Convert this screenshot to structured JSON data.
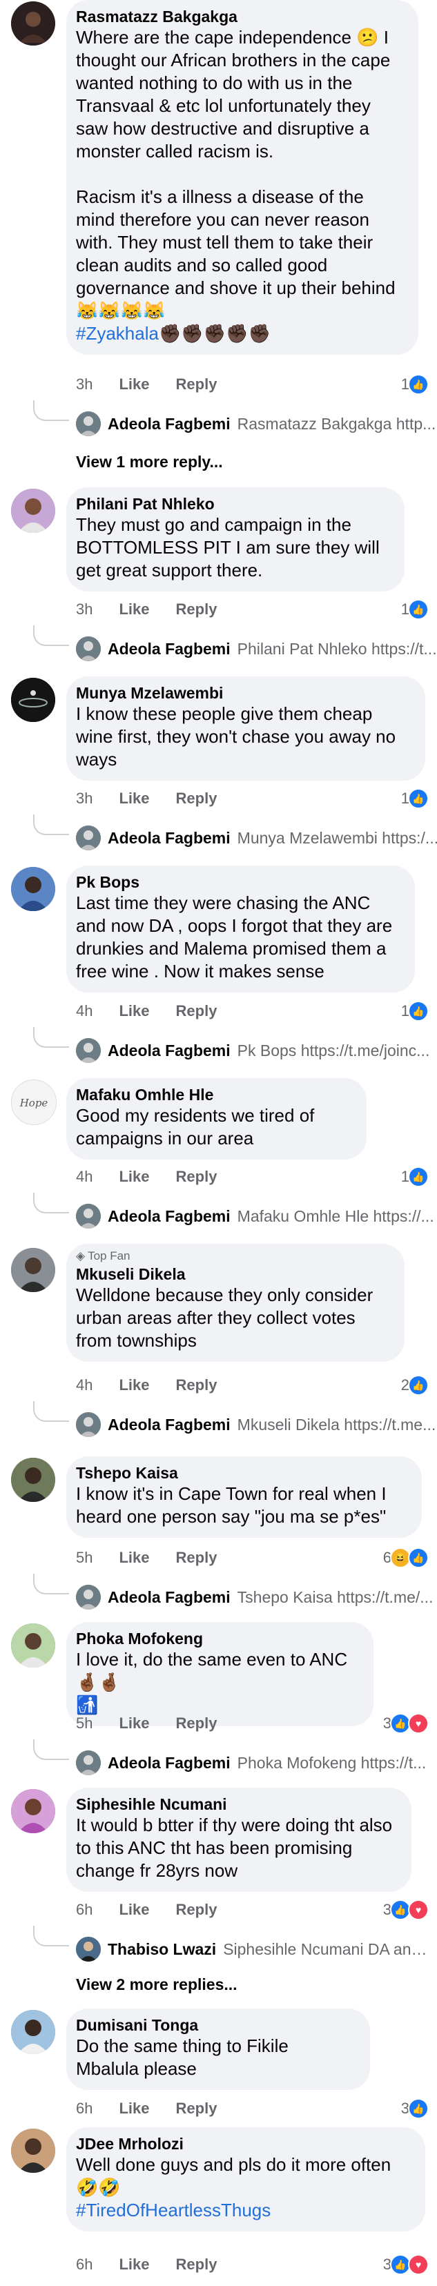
{
  "comments": [
    {
      "author": "Rasmatazz Bakgakga",
      "text": "Where are the cape independence 😕 I thought our African brothers in the cape wanted nothing to do with us in the Transvaal & etc lol unfortunately they saw how destructive and disruptive a monster called racism is.\n\nRacism it's a illness a disease of the mind therefore you can never reason with. They must tell them to take their clean audits and so called good governance and shove it up their behind 😹😹😹😹",
      "hashtag": "#Zyakhala",
      "hashtag_suffix": "✊🏿✊🏿✊🏿✊🏿✊🏿",
      "time": "3h",
      "like": "Like",
      "reply": "Reply",
      "reactions": "1",
      "reply_author": "Adeola Fagbemi",
      "reply_snippet": "Rasmatazz Bakgakga http...",
      "more_replies": "View 1 more reply..."
    },
    {
      "author": "Philani Pat Nhleko",
      "text": "They must go and campaign in the BOTTOMLESS PIT I am sure they will get great support there.",
      "time": "3h",
      "like": "Like",
      "reply": "Reply",
      "reactions": "1",
      "reply_author": "Adeola Fagbemi",
      "reply_snippet": "Philani Pat Nhleko https://t..."
    },
    {
      "author": "Munya Mzelawembi",
      "text": "I know these people give them cheap wine first, they won't chase you away no ways",
      "time": "3h",
      "like": "Like",
      "reply": "Reply",
      "reactions": "1",
      "reply_author": "Adeola Fagbemi",
      "reply_snippet": "Munya Mzelawembi https:/..."
    },
    {
      "author": "Pk Bops",
      "text": "Last time they were chasing the ANC and now DA , oops I forgot that they are drunkies and Malema promised them a free wine . Now it makes sense",
      "time": "4h",
      "like": "Like",
      "reply": "Reply",
      "reactions": "1",
      "reply_author": "Adeola Fagbemi",
      "reply_snippet": "Pk Bops https://t.me/joinc..."
    },
    {
      "author": "Mafaku Omhle Hle",
      "avatar_text": "Hope",
      "text": "Good my residents we tired of campaigns in our area",
      "time": "4h",
      "like": "Like",
      "reply": "Reply",
      "reactions": "1",
      "reply_author": "Adeola Fagbemi",
      "reply_snippet": "Mafaku Omhle Hle https://..."
    },
    {
      "author": "Mkuseli Dikela",
      "badge": "Top Fan",
      "text": "Welldone because they only consider urban areas after they collect votes from townships",
      "time": "4h",
      "like": "Like",
      "reply": "Reply",
      "reactions": "2",
      "reply_author": "Adeola Fagbemi",
      "reply_snippet": "Mkuseli Dikela https://t.me..."
    },
    {
      "author": "Tshepo Kaisa",
      "text": "I know it's in Cape Town for real when I heard one person say \"jou ma se p*es\"",
      "time": "5h",
      "like": "Like",
      "reply": "Reply",
      "reactions": "6",
      "reply_author": "Adeola Fagbemi",
      "reply_snippet": "Tshepo Kaisa https://t.me/..."
    },
    {
      "author": "Phoka Mofokeng",
      "text": "I love it, do the same even to ANC 🤞🏾🤞🏾\n🚮",
      "time": "5h",
      "like": "Like",
      "reply": "Reply",
      "reactions": "3",
      "reply_author": "Adeola Fagbemi",
      "reply_snippet": "Phoka Mofokeng https://t..."
    },
    {
      "author": "Siphesihle Ncumani",
      "text": "It would b btter if thy were doing tht also to this ANC tht has been promising change fr 28yrs now",
      "time": "6h",
      "like": "Like",
      "reply": "Reply",
      "reactions": "3",
      "reply_author": "Thabiso Lwazi",
      "reply_snippet": "Siphesihle Ncumani DA and...",
      "more_replies": "View 2 more replies..."
    },
    {
      "author": "Dumisani Tonga",
      "text": "Do the same thing to Fikile Mbalula please",
      "time": "6h",
      "like": "Like",
      "reply": "Reply",
      "reactions": "3"
    },
    {
      "author": "JDee Mrholozi",
      "text": "Well done guys and pls do it more often 🤣🤣",
      "hashtag": "#TiredOfHeartlessThugs",
      "time": "6h",
      "like": "Like",
      "reply": "Reply",
      "reactions": "3"
    }
  ],
  "icons": {
    "like": "like-reaction-icon",
    "love": "love-reaction-icon",
    "haha": "haha-reaction-icon",
    "topfan": "top-fan-icon"
  },
  "colors": {
    "bubble": "#f0f2f5",
    "meta": "#65676b",
    "hashtag": "#216fdb",
    "like": "#1877f2",
    "love": "#f33e58"
  }
}
